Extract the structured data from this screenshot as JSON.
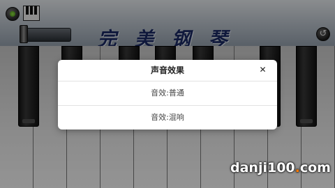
{
  "app": {
    "logo_text": "完美钢琴",
    "reset_glyph": "↺"
  },
  "dialog": {
    "title": "声音效果",
    "close_glyph": "✕",
    "options": [
      {
        "label": "音效:普通"
      },
      {
        "label": "音效:混响"
      }
    ]
  },
  "watermark": {
    "text_before": "danji100",
    "dot": ".",
    "text_after": "com"
  },
  "colors": {
    "logo": "#1b2a66",
    "watermark_dot": "#ff7a00"
  },
  "icons": [
    "record-icon",
    "keyboard-icon",
    "volume-slider",
    "reset-icon",
    "close-icon"
  ]
}
